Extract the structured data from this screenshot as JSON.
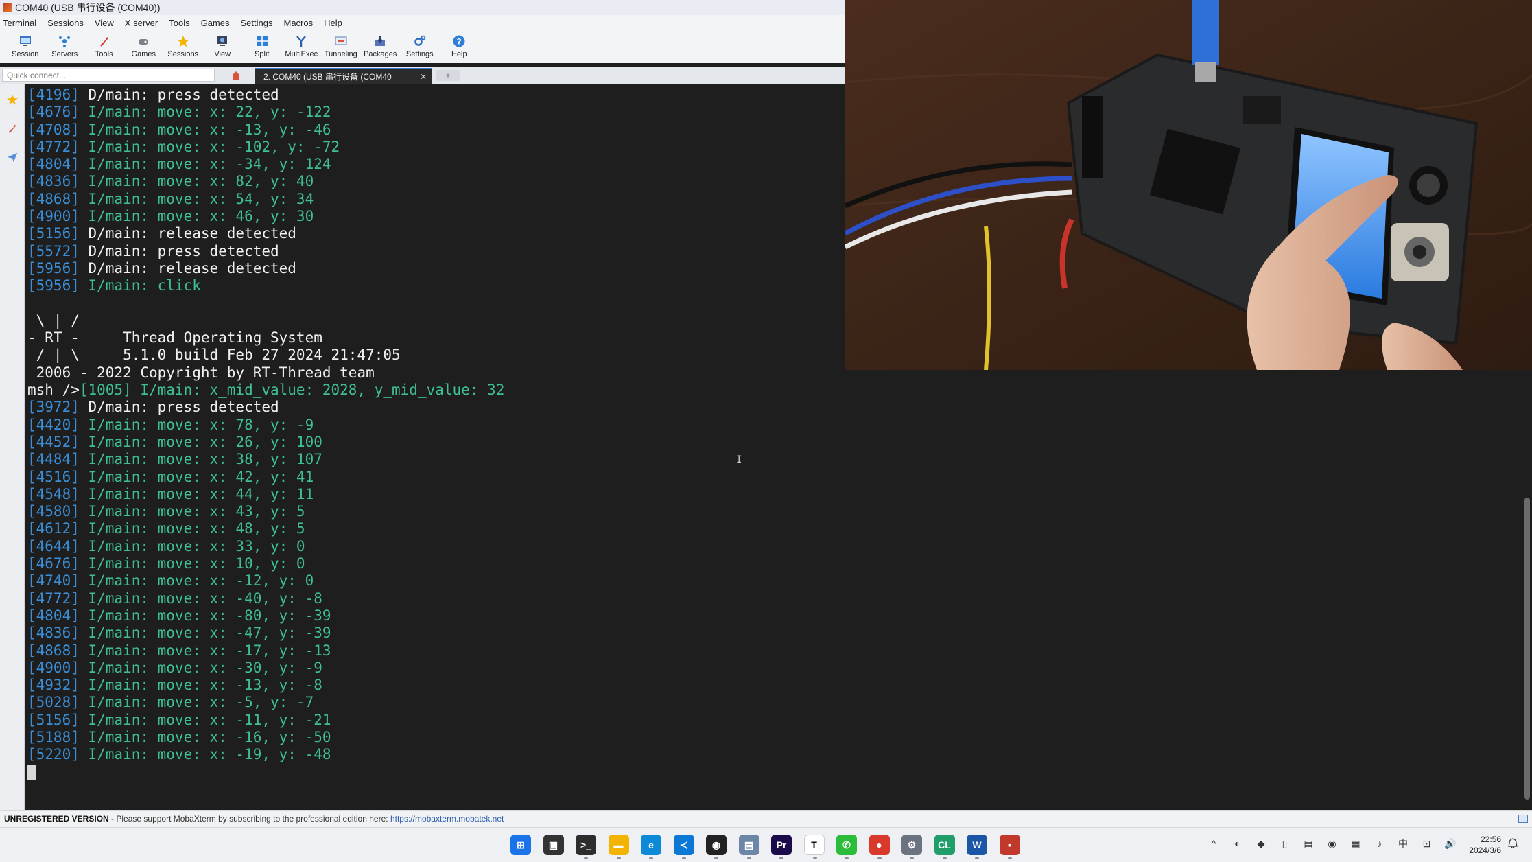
{
  "window": {
    "title": "COM40  (USB 串行设备 (COM40))"
  },
  "menu": [
    "Terminal",
    "Sessions",
    "View",
    "X server",
    "Tools",
    "Games",
    "Settings",
    "Macros",
    "Help"
  ],
  "toolbar": [
    {
      "label": "Session",
      "icon": "session-icon"
    },
    {
      "label": "Servers",
      "icon": "servers-icon"
    },
    {
      "label": "Tools",
      "icon": "tools-icon"
    },
    {
      "label": "Games",
      "icon": "games-icon"
    },
    {
      "label": "Sessions",
      "icon": "star-icon"
    },
    {
      "label": "View",
      "icon": "view-icon"
    },
    {
      "label": "Split",
      "icon": "split-icon"
    },
    {
      "label": "MultiExec",
      "icon": "multiexec-icon"
    },
    {
      "label": "Tunneling",
      "icon": "tunneling-icon"
    },
    {
      "label": "Packages",
      "icon": "packages-icon"
    },
    {
      "label": "Settings",
      "icon": "gear-icon"
    },
    {
      "label": "Help",
      "icon": "help-icon"
    }
  ],
  "quick_connect": {
    "placeholder": "Quick connect..."
  },
  "tabs": {
    "active_label": "2. COM40  (USB 串行设备 (COM40",
    "close": "✕",
    "new_tab": "+"
  },
  "terminal": {
    "lines": [
      {
        "ts": "[4196]",
        "text": " D/main: press detected",
        "level": "d"
      },
      {
        "ts": "[4676]",
        "text": " I/main: move: x: 22, y: -122",
        "level": "i"
      },
      {
        "ts": "[4708]",
        "text": " I/main: move: x: -13, y: -46",
        "level": "i"
      },
      {
        "ts": "[4772]",
        "text": " I/main: move: x: -102, y: -72",
        "level": "i"
      },
      {
        "ts": "[4804]",
        "text": " I/main: move: x: -34, y: 124",
        "level": "i"
      },
      {
        "ts": "[4836]",
        "text": " I/main: move: x: 82, y: 40",
        "level": "i"
      },
      {
        "ts": "[4868]",
        "text": " I/main: move: x: 54, y: 34",
        "level": "i"
      },
      {
        "ts": "[4900]",
        "text": " I/main: move: x: 46, y: 30",
        "level": "i"
      },
      {
        "ts": "[5156]",
        "text": " D/main: release detected",
        "level": "d"
      },
      {
        "ts": "[5572]",
        "text": " D/main: press detected",
        "level": "d"
      },
      {
        "ts": "[5956]",
        "text": " D/main: release detected",
        "level": "d"
      },
      {
        "ts": "[5956]",
        "text": " I/main: click",
        "level": "i"
      },
      {
        "ts": "",
        "text": "",
        "level": "w"
      },
      {
        "ts": "",
        "text": " \\ | /",
        "level": "w"
      },
      {
        "ts": "",
        "text": "- RT -     Thread Operating System",
        "level": "w"
      },
      {
        "ts": "",
        "text": " / | \\     5.1.0 build Feb 27 2024 21:47:05",
        "level": "w"
      },
      {
        "ts": "",
        "text": " 2006 - 2022 Copyright by RT-Thread team",
        "level": "w"
      },
      {
        "ts": "msh />",
        "text": "[1005] I/main: x_mid_value: 2028, y_mid_value: 32",
        "level": "msh"
      },
      {
        "ts": "[3972]",
        "text": " D/main: press detected",
        "level": "d"
      },
      {
        "ts": "[4420]",
        "text": " I/main: move: x: 78, y: -9",
        "level": "i"
      },
      {
        "ts": "[4452]",
        "text": " I/main: move: x: 26, y: 100",
        "level": "i"
      },
      {
        "ts": "[4484]",
        "text": " I/main: move: x: 38, y: 107",
        "level": "i"
      },
      {
        "ts": "[4516]",
        "text": " I/main: move: x: 42, y: 41",
        "level": "i"
      },
      {
        "ts": "[4548]",
        "text": " I/main: move: x: 44, y: 11",
        "level": "i"
      },
      {
        "ts": "[4580]",
        "text": " I/main: move: x: 43, y: 5",
        "level": "i"
      },
      {
        "ts": "[4612]",
        "text": " I/main: move: x: 48, y: 5",
        "level": "i"
      },
      {
        "ts": "[4644]",
        "text": " I/main: move: x: 33, y: 0",
        "level": "i"
      },
      {
        "ts": "[4676]",
        "text": " I/main: move: x: 10, y: 0",
        "level": "i"
      },
      {
        "ts": "[4740]",
        "text": " I/main: move: x: -12, y: 0",
        "level": "i"
      },
      {
        "ts": "[4772]",
        "text": " I/main: move: x: -40, y: -8",
        "level": "i"
      },
      {
        "ts": "[4804]",
        "text": " I/main: move: x: -80, y: -39",
        "level": "i"
      },
      {
        "ts": "[4836]",
        "text": " I/main: move: x: -47, y: -39",
        "level": "i"
      },
      {
        "ts": "[4868]",
        "text": " I/main: move: x: -17, y: -13",
        "level": "i"
      },
      {
        "ts": "[4900]",
        "text": " I/main: move: x: -30, y: -9",
        "level": "i"
      },
      {
        "ts": "[4932]",
        "text": " I/main: move: x: -13, y: -8",
        "level": "i"
      },
      {
        "ts": "[5028]",
        "text": " I/main: move: x: -5, y: -7",
        "level": "i"
      },
      {
        "ts": "[5156]",
        "text": " I/main: move: x: -11, y: -21",
        "level": "i"
      },
      {
        "ts": "[5188]",
        "text": " I/main: move: x: -16, y: -50",
        "level": "i"
      },
      {
        "ts": "[5220]",
        "text": " I/main: move: x: -19, y: -48",
        "level": "i"
      }
    ],
    "colors": {
      "timestamp": "#3a8fd8",
      "debug": "#f0f0f0",
      "info": "#3fbf96",
      "background": "#1e1e1e"
    }
  },
  "statusbar": {
    "unregistered": "UNREGISTERED VERSION",
    "message": "  -  Please support MobaXterm by subscribing to the professional edition here:  ",
    "link": "https://mobaxterm.mobatek.net"
  },
  "clock": {
    "time": "22:56",
    "date": "2024/3/6"
  },
  "taskbar_apps": [
    {
      "name": "start-icon",
      "color": "#1a73e8",
      "glyph": "⊞"
    },
    {
      "name": "task-view-icon",
      "color": "#333",
      "glyph": "▣"
    },
    {
      "name": "terminal-icon",
      "color": "#2d2d2d",
      "glyph": ">_"
    },
    {
      "name": "file-explorer-icon",
      "color": "#f2b400",
      "glyph": "▬"
    },
    {
      "name": "edge-icon",
      "color": "#0c8ad8",
      "glyph": "e"
    },
    {
      "name": "vscode-icon",
      "color": "#0a78d4",
      "glyph": "≺"
    },
    {
      "name": "qq-icon",
      "color": "#222",
      "glyph": "◉"
    },
    {
      "name": "monitor-app-icon",
      "color": "#6c86a8",
      "glyph": "▤"
    },
    {
      "name": "premiere-icon",
      "color": "#1c0b4a",
      "glyph": "Pr"
    },
    {
      "name": "typora-icon",
      "color": "#ffffff",
      "glyph": "T"
    },
    {
      "name": "wechat-icon",
      "color": "#2bbd3a",
      "glyph": "✆"
    },
    {
      "name": "media-app-icon",
      "color": "#d8392b",
      "glyph": "●"
    },
    {
      "name": "settings-icon",
      "color": "#6b7280",
      "glyph": "⚙"
    },
    {
      "name": "clion-icon",
      "color": "#1f9e6a",
      "glyph": "CL"
    },
    {
      "name": "word-app-icon",
      "color": "#1a55a6",
      "glyph": "W"
    },
    {
      "name": "mobaxterm-icon",
      "color": "#c0392b",
      "glyph": "▪"
    }
  ],
  "tray": [
    "^",
    "◐",
    "◆",
    "▯",
    "▤",
    "◉",
    "▦",
    "♪",
    "中",
    "⊡",
    "🔊"
  ]
}
